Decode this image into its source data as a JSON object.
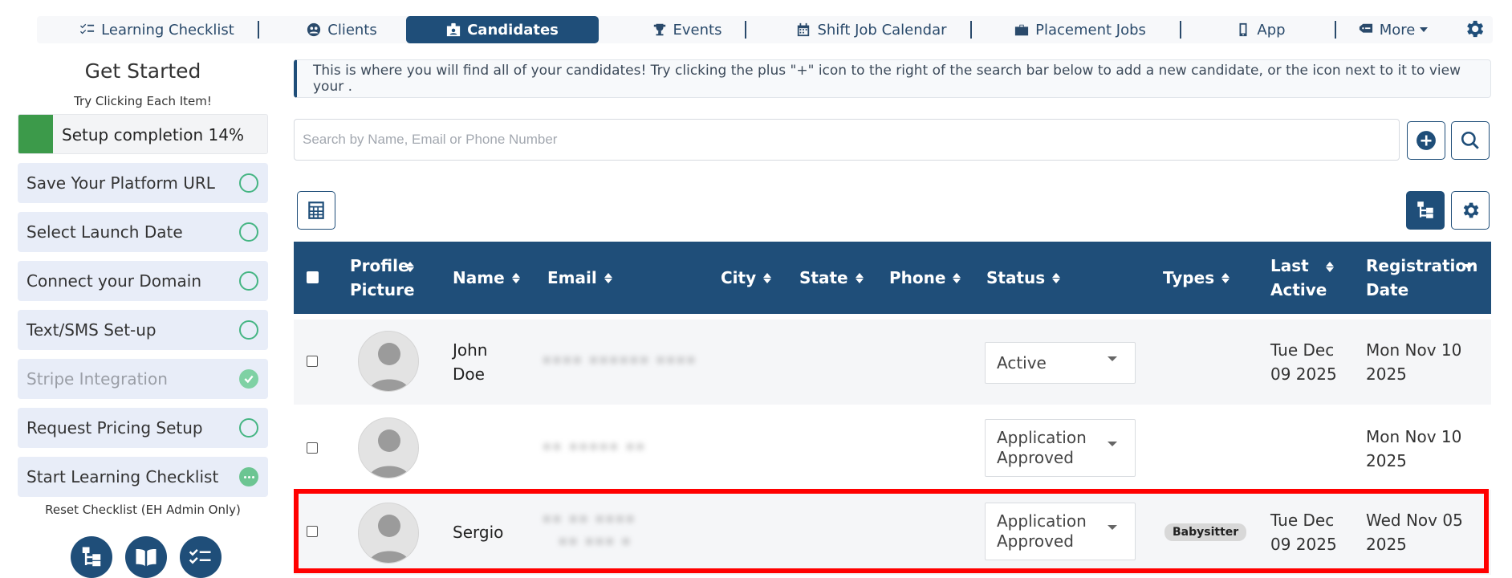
{
  "nav": {
    "items": [
      {
        "label": "Learning Checklist",
        "icon": "checklist-icon"
      },
      {
        "label": "Clients",
        "icon": "clients-icon"
      },
      {
        "label": "Candidates",
        "icon": "id-card-icon",
        "active": true
      },
      {
        "label": "Events",
        "icon": "trophy-icon"
      },
      {
        "label": "Shift Job Calendar",
        "icon": "calendar-icon"
      },
      {
        "label": "Placement Jobs",
        "icon": "briefcase-icon"
      },
      {
        "label": "App",
        "icon": "mobile-icon"
      },
      {
        "label": "More",
        "icon": "tag-icon"
      }
    ]
  },
  "sidebar": {
    "title": "Get Started",
    "subtitle": "Try Clicking Each Item!",
    "progress_label": "Setup completion 14%",
    "progress_fraction": 0.14,
    "items": [
      {
        "label": "Save Your Platform URL",
        "status": "open"
      },
      {
        "label": "Select Launch Date",
        "status": "open"
      },
      {
        "label": "Connect your Domain",
        "status": "open"
      },
      {
        "label": "Text/SMS Set-up",
        "status": "open"
      },
      {
        "label": "Stripe Integration",
        "status": "done"
      },
      {
        "label": "Request Pricing Setup",
        "status": "open"
      },
      {
        "label": "Start Learning Checklist",
        "status": "in-progress"
      }
    ],
    "reset_label": "Reset Checklist (EH Admin Only)"
  },
  "info": {
    "text": "This is where you will find all of your candidates! Try clicking the plus \"+\" icon to the right of the search bar below to add a new candidate, or the icon next to it to view your ."
  },
  "search": {
    "placeholder": "Search by Name, Email or Phone Number"
  },
  "table": {
    "columns": {
      "profile_picture": "Profile Picture",
      "name": "Name",
      "email": "Email",
      "city": "City",
      "state": "State",
      "phone": "Phone",
      "status": "Status",
      "types": "Types",
      "last_active": "Last Active",
      "registration_date": "Registration Date"
    },
    "rows": [
      {
        "name": "John Doe",
        "email_blurred": "•••• •••••• ••••",
        "status": "Active",
        "type": "",
        "last_active": "Tue Dec 09 2025",
        "registration_date": "Mon Nov 10 2025"
      },
      {
        "name": "",
        "email_blurred": "•• ••••• ••",
        "status": "Application Approved",
        "type": "",
        "last_active": "",
        "registration_date": "Mon Nov 10 2025"
      },
      {
        "name": "Sergio",
        "email_blurred": "•• •• ••••",
        "email_blurred_2": "•• ••• •",
        "status": "Application Approved",
        "type": "Babysitter",
        "last_active": "Tue Dec 09 2025",
        "registration_date": "Wed Nov 05 2025"
      }
    ]
  },
  "colors": {
    "primary": "#1f4e79",
    "progress": "#3c9a4a",
    "highlight": "#ff0000"
  }
}
